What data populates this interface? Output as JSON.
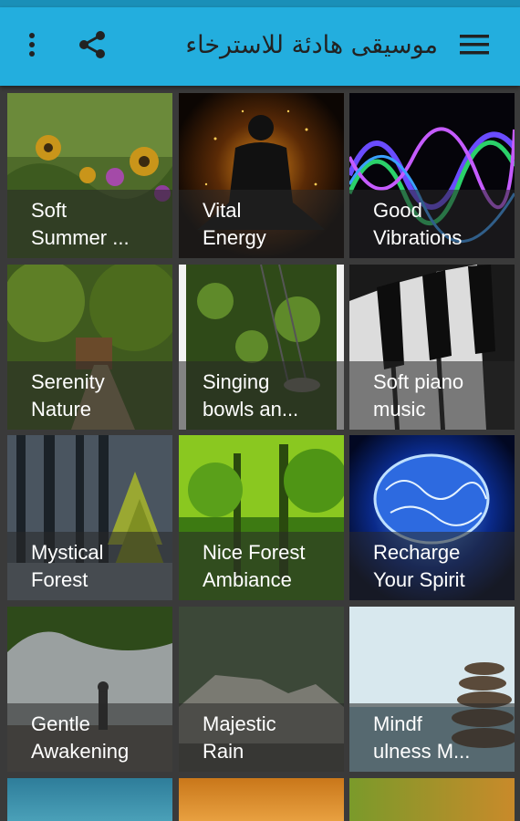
{
  "appbar": {
    "title": "موسيقى هادئة للاسترخاء",
    "left_icons": [
      "more-vert-icon",
      "share-icon"
    ],
    "right_icon": "hamburger-menu-icon",
    "color": "#23aede"
  },
  "tiles": [
    {
      "line1": "Soft",
      "line2": "Summer ..."
    },
    {
      "line1": "Vital",
      "line2": "Energy"
    },
    {
      "line1": "Good",
      "line2": "Vibrations"
    },
    {
      "line1": "Serenity",
      "line2": "Nature"
    },
    {
      "line1": "Singing",
      "line2": "bowls an..."
    },
    {
      "line1": "Soft piano",
      "line2": "music"
    },
    {
      "line1": "Mystical",
      "line2": "Forest"
    },
    {
      "line1": "Nice Forest",
      "line2": "Ambiance"
    },
    {
      "line1": "Recharge",
      "line2": "Your Spirit"
    },
    {
      "line1": "Gentle",
      "line2": "Awakening"
    },
    {
      "line1": "Majestic",
      "line2": "Rain"
    },
    {
      "line1": "Mindf",
      "line2": "ulness M..."
    }
  ]
}
